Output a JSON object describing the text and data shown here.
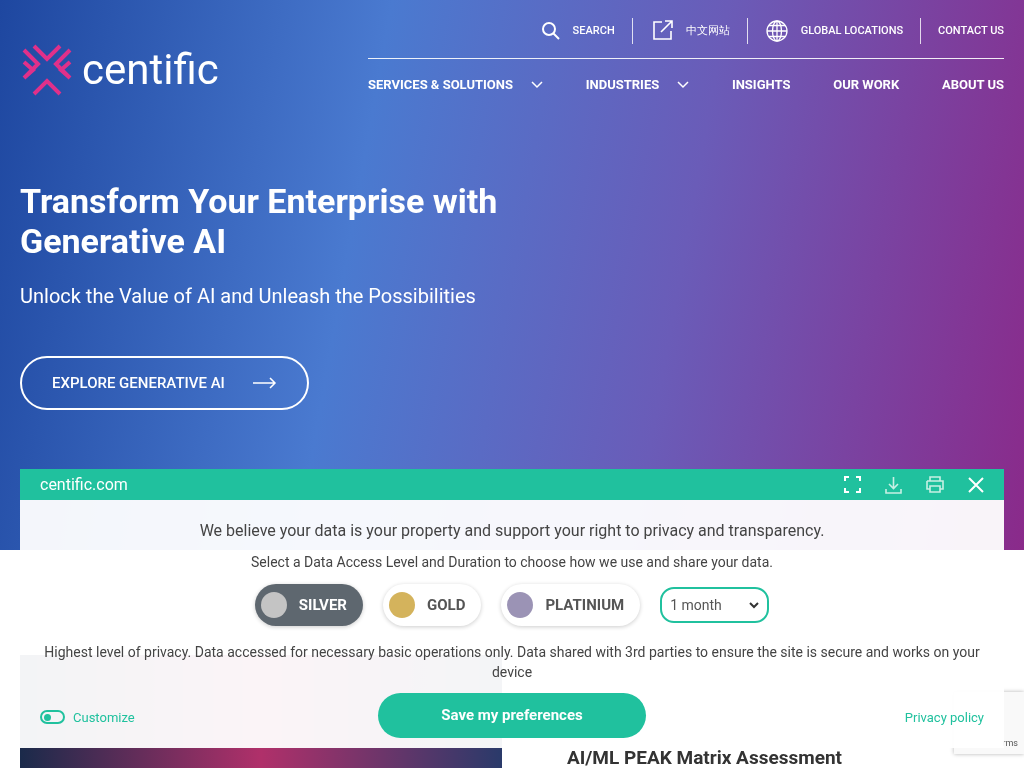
{
  "header": {
    "logo": "centific",
    "top_links": [
      {
        "kind": "search",
        "label": "SEARCH"
      },
      {
        "kind": "external",
        "label": "中文网站"
      },
      {
        "kind": "globe",
        "label": "GLOBAL LOCATIONS"
      },
      {
        "kind": "none",
        "label": "CONTACT US"
      }
    ],
    "nav": [
      {
        "label": "SERVICES & SOLUTIONS",
        "has_dropdown": true
      },
      {
        "label": "INDUSTRIES",
        "has_dropdown": true
      },
      {
        "label": "INSIGHTS",
        "has_dropdown": false
      },
      {
        "label": "OUR WORK",
        "has_dropdown": false
      },
      {
        "label": "ABOUT US",
        "has_dropdown": false
      }
    ]
  },
  "hero": {
    "title": "Transform Your Enterprise with Generative AI",
    "subtitle": "Unlock the Value of AI and Unleash the Possibilities",
    "button": "EXPLORE GENERATIVE AI"
  },
  "article": {
    "title": "AI/ML PEAK Matrix Assessment"
  },
  "recaptcha": {
    "text": "rms"
  },
  "consent": {
    "site": "centific.com",
    "heading": "We believe your data is your property and support your right to privacy and transparency.",
    "instruction": "Select a Data Access Level and Duration to choose how we use and share your data.",
    "levels": [
      {
        "label": "SILVER",
        "color": "#c4c4c4",
        "selected": true
      },
      {
        "label": "GOLD",
        "color": "#d4b35c",
        "selected": false
      },
      {
        "label": "PLATINIUM",
        "color": "#9b93b5",
        "selected": false
      }
    ],
    "duration": "1 month",
    "description": "Highest level of privacy. Data accessed for necessary basic operations only. Data shared with 3rd parties to ensure the site is secure and works on your device",
    "customize": {
      "label": "Customize",
      "on": false
    },
    "save": "Save my preferences",
    "privacy": "Privacy policy"
  }
}
